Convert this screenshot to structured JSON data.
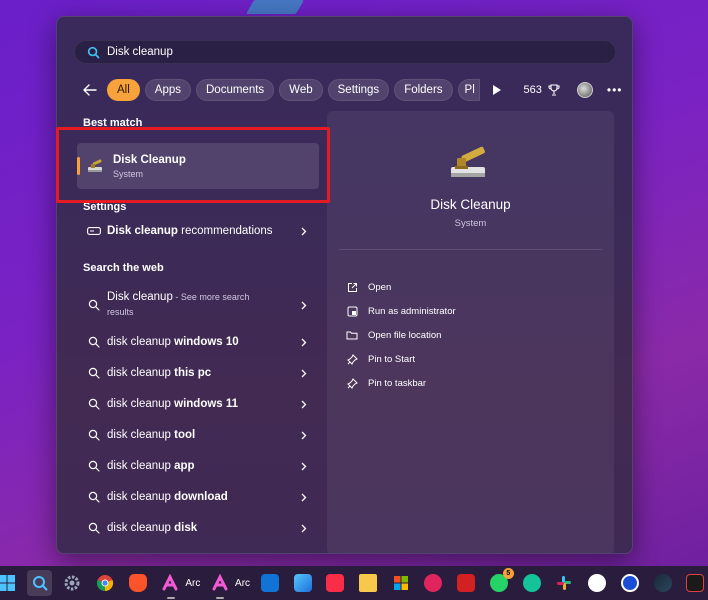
{
  "search": {
    "value": "Disk cleanup",
    "placeholder": ""
  },
  "filters": {
    "chips": [
      "All",
      "Apps",
      "Documents",
      "Web",
      "Settings",
      "Folders",
      "Pl"
    ],
    "active": "All",
    "points": "563"
  },
  "best_match": {
    "heading": "Best match",
    "title": "Disk Cleanup",
    "subtitle": "System"
  },
  "settings": {
    "heading": "Settings",
    "items": [
      {
        "bold": "Disk cleanup",
        "rest": " recommendations"
      }
    ]
  },
  "web": {
    "heading": "Search the web",
    "first": {
      "bold": "Disk cleanup",
      "rest": " - See more search",
      "rest2": "results"
    },
    "items": [
      {
        "normal": "disk cleanup ",
        "bold": "windows 10"
      },
      {
        "normal": "disk cleanup ",
        "bold": "this pc"
      },
      {
        "normal": "disk cleanup ",
        "bold": "windows 11"
      },
      {
        "normal": "disk cleanup ",
        "bold": "tool"
      },
      {
        "normal": "disk cleanup ",
        "bold": "app"
      },
      {
        "normal": "disk cleanup ",
        "bold": "download"
      },
      {
        "normal": "disk cleanup ",
        "bold": "disk"
      }
    ]
  },
  "preview": {
    "title": "Disk Cleanup",
    "subtitle": "System",
    "actions": [
      "Open",
      "Run as administrator",
      "Open file location",
      "Pin to Start",
      "Pin to taskbar"
    ]
  },
  "taskbar": {
    "arc_label_1": "Arc",
    "arc_label_2": "Arc",
    "whatsapp_badge": "5"
  },
  "colors": {
    "accent": "#f7a23a",
    "highlight_box": "#e51b24"
  }
}
